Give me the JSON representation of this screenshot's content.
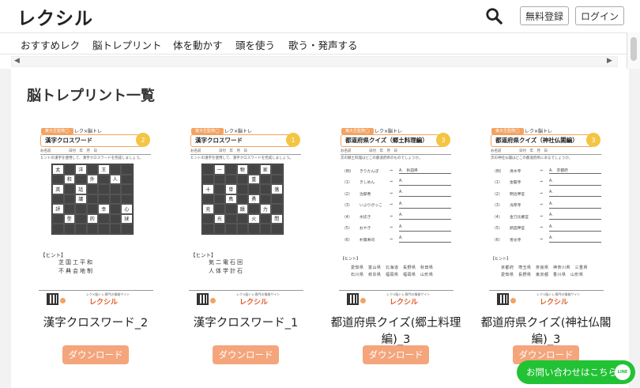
{
  "header": {
    "logo": "レクシル",
    "register_label": "無料登録",
    "login_label": "ログイン"
  },
  "nav": {
    "items": [
      {
        "label": "おすすめレク"
      },
      {
        "label": "脳トレプリント"
      },
      {
        "label": "体を動かす"
      },
      {
        "label": "頭を使う"
      },
      {
        "label": "歌う・発声する"
      }
    ]
  },
  "main": {
    "title": "脳トレプリント一覧",
    "download_label": "ダウンロード"
  },
  "cards": [
    {
      "title": "漢字クロスワード_2",
      "ws_tag": "東大生監修◯",
      "ws_tag2": "レク×脳トレ",
      "ws_title": "漢字クロスワード",
      "ws_badge": "2",
      "ws_meta": "お名前　　　　　日付　年　月　日",
      "ws_inst": "ヒントの漢字を使用して、漢字クロスワードを完成しましょう。",
      "hint_h": "【ヒント】",
      "hint1": "芝国工平和",
      "hint2": "不典会地制"
    },
    {
      "title": "漢字クロスワード_1",
      "ws_tag": "東大生監修◯",
      "ws_tag2": "レク×脳トレ",
      "ws_title": "漢字クロスワード",
      "ws_badge": "1",
      "ws_meta": "お名前　　　　　日付　年　月　日",
      "ws_inst": "ヒントの漢字を使用して、漢字クロスワードを完成しましょう。",
      "hint_h": "【ヒント】",
      "hint1": "気二電石回",
      "hint2": "人体学計石"
    },
    {
      "title": "都道府県クイズ(郷土料理編)_3",
      "ws_tag": "東大生監修◯",
      "ws_tag2": "レク×脳トレ",
      "ws_title": "都道府県クイズ（郷土料理編）",
      "ws_badge": "3",
      "ws_meta": "お名前　　　　　日付　年　月　日",
      "ws_inst": "次の郷土料理はどこの都道府県のものでしょうか。",
      "qs": [
        {
          "n": "（例）",
          "t": "きりたんぽ",
          "a": "A.　秋田県"
        },
        {
          "n": "（1）",
          "t": "きしめん",
          "a": "A."
        },
        {
          "n": "（2）",
          "t": "治部煮",
          "a": "A."
        },
        {
          "n": "（3）",
          "t": "いぶりがっこ",
          "a": "A."
        },
        {
          "n": "（4）",
          "t": "水炊き",
          "a": "A."
        },
        {
          "n": "（5）",
          "t": "おやき",
          "a": "A."
        },
        {
          "n": "（6）",
          "t": "朴葉寿司",
          "a": "A."
        }
      ],
      "ans_h": "【ヒント】",
      "ans1": "愛知県　富山県　北海道　長野県　秋田県",
      "ans2": "石川県　岐阜県　福岡県　福岡県　山形県"
    },
    {
      "title": "都道府県クイズ(神社仏閣編)_3",
      "ws_tag": "東大生監修◯",
      "ws_tag2": "レク×脳トレ",
      "ws_title": "都道府県クイズ（神社仏閣編）",
      "ws_badge": "3",
      "ws_meta": "お名前　　　　　日付　年　月　日",
      "ws_inst": "次の神社仏閣はどこの都道府県にあるでしょうか。",
      "qs": [
        {
          "n": "（例）",
          "t": "清水寺",
          "a": "A.　京都府"
        },
        {
          "n": "（1）",
          "t": "金閣寺",
          "a": "A."
        },
        {
          "n": "（2）",
          "t": "明治神宮",
          "a": "A."
        },
        {
          "n": "（3）",
          "t": "浅草寺",
          "a": "A."
        },
        {
          "n": "（4）",
          "t": "金刀比羅宮",
          "a": "A."
        },
        {
          "n": "（5）",
          "t": "熱田神宮",
          "a": "A."
        },
        {
          "n": "（6）",
          "t": "善光寺",
          "a": "A."
        }
      ],
      "ans_h": "【ヒント】",
      "ans1": "京都府　埼玉県　奈良県　神奈川県　三重県",
      "ans2": "愛知県　長野県　東京都　香川県　山形県"
    }
  ],
  "crossword1": [
    "太",
    "",
    "洋",
    "",
    "王",
    "",
    "",
    "",
    "和",
    "",
    "外",
    "",
    "人",
    "",
    "英",
    "",
    "話",
    "",
    "",
    "",
    "",
    "",
    "",
    "議",
    "",
    "",
    "",
    "",
    "評",
    "",
    "",
    "",
    "幸",
    "",
    "心",
    "",
    "型",
    "",
    "的",
    "",
    "",
    "球",
    "",
    "",
    "",
    "",
    "",
    "",
    ""
  ],
  "crossword2": [
    "",
    "一",
    "",
    "物",
    "",
    "家",
    "",
    "",
    "",
    "",
    "",
    "重",
    "",
    "",
    "十",
    "",
    "単",
    "",
    "",
    "",
    "落",
    "",
    "",
    "鳥",
    "",
    "勇",
    "",
    "",
    "充",
    "",
    "",
    "韻",
    "",
    "力",
    "",
    "",
    "光",
    "",
    "",
    "火",
    "",
    "問",
    "",
    "",
    "",
    "",
    "",
    "",
    ""
  ],
  "brand": {
    "small": "レク×脳トレ専門の情報サイト",
    "name": "レクシル"
  },
  "contact": {
    "label": "お問い合わせはこちら",
    "line": "LINE"
  },
  "colors": {
    "accent": "#f4a57c",
    "line_green": "#22c235"
  }
}
